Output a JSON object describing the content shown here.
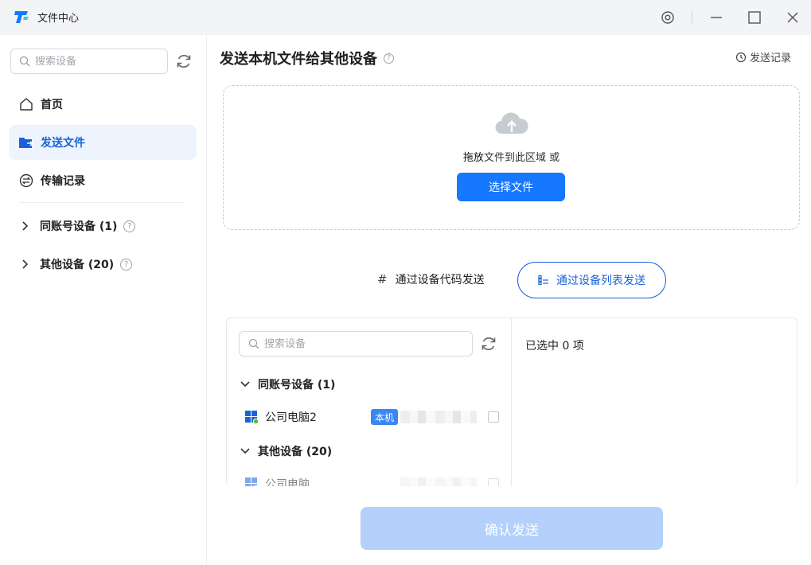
{
  "app": {
    "title": "文件中心"
  },
  "sidebar": {
    "search_placeholder": "搜索设备",
    "items": [
      {
        "label": "首页",
        "icon": "home-icon",
        "active": false
      },
      {
        "label": "发送文件",
        "icon": "folder-send-icon",
        "active": true
      },
      {
        "label": "传输记录",
        "icon": "transfer-icon",
        "active": false
      }
    ],
    "groups": [
      {
        "label": "同账号设备 (1)"
      },
      {
        "label": "其他设备 (20)"
      }
    ]
  },
  "main": {
    "title": "发送本机文件给其他设备",
    "history_label": "发送记录",
    "dropzone": {
      "text_strong": "拖放",
      "text_rest": "文件到此区域 或",
      "select_button": "选择文件"
    },
    "modes": {
      "code_label": "通过设备代码发送",
      "list_label": "通过设备列表发送"
    },
    "panel": {
      "search_placeholder": "搜索设备",
      "groups": [
        {
          "label": "同账号设备 (1)"
        },
        {
          "label": "其他设备 (20)"
        }
      ],
      "devices": [
        {
          "name": "公司电脑2",
          "badge": "本机"
        },
        {
          "name": "公司电脑"
        }
      ],
      "selected_text": "已选中 0 项"
    },
    "confirm_button": "确认发送"
  },
  "colors": {
    "accent": "#1677ff",
    "active_bg": "#eef4fd",
    "confirm_disabled": "#b3d1fb",
    "online_dot": "#52c41a"
  }
}
